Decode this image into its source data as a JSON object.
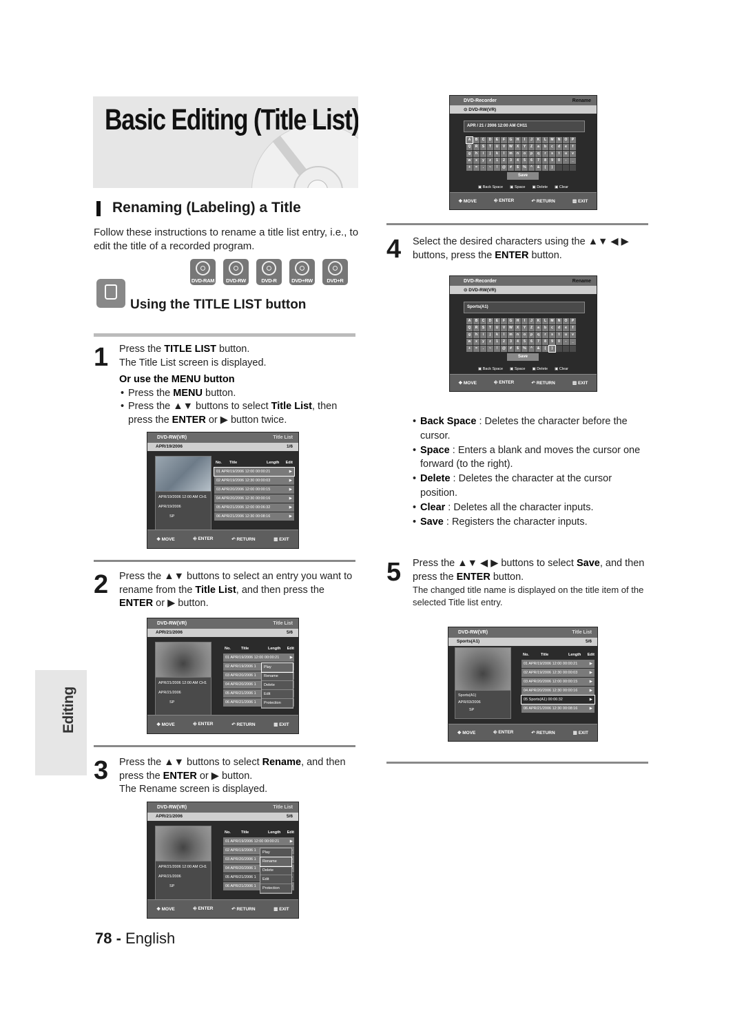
{
  "banner": {
    "title": "Basic Editing (Title List)"
  },
  "section": {
    "title": "Renaming (Labeling) a Title",
    "intro": "Follow these instructions to rename a title list entry, i.e., to edit the title of a recorded program."
  },
  "disc_icons": [
    "DVD-RAM",
    "DVD-RW",
    "DVD-R",
    "DVD+RW",
    "DVD+R"
  ],
  "subsection": {
    "title": "Using the TITLE LIST button"
  },
  "steps": {
    "s1": {
      "num": "1",
      "l1a": "Press the ",
      "l1b": "TITLE LIST",
      "l1c": " button.",
      "l2": "The Title List screen is displayed.",
      "or_heading": "Or use the MENU button",
      "b1a": "Press the ",
      "b1b": "MENU",
      "b1c": " button.",
      "b2a": "Press the ▲▼ buttons to select ",
      "b2b": "Title List",
      "b2c": ", then press the ",
      "b2d": "ENTER",
      "b2e": " or ▶ button twice."
    },
    "s2": {
      "num": "2",
      "a": "Press the ▲▼ buttons to select an entry you want to rename from the ",
      "b": "Title List",
      "c": ", and then press the ",
      "d": "ENTER",
      "e": " or ▶ button."
    },
    "s3": {
      "num": "3",
      "a": "Press the ▲▼  buttons to select ",
      "b": "Rename",
      "c": ", and then press the ",
      "d": "ENTER",
      "e": " or ▶ button.",
      "f": "The Rename screen is displayed."
    },
    "s4": {
      "num": "4",
      "a": "Select the desired characters using the ▲▼ ◀ ▶ buttons, press the ",
      "b": "ENTER",
      "c": " button."
    },
    "s5": {
      "num": "5",
      "a": "Press the ▲▼ ◀ ▶  buttons to select ",
      "b": "Save",
      "c": ", and then press the ",
      "d": "ENTER",
      "e": " button.",
      "f": "The changed title name is displayed on the title item of the selected Title list entry."
    }
  },
  "key_help": [
    {
      "term": "Back Space",
      "desc": " : Deletes the character before the cursor."
    },
    {
      "term": "Space",
      "desc": " : Enters a blank and moves the cursor one forward (to the right)."
    },
    {
      "term": "Delete",
      "desc": " : Deletes the character at the cursor position."
    },
    {
      "term": "Clear",
      "desc": " : Deletes all the character inputs."
    },
    {
      "term": "Save",
      "desc": " : Registers the character inputs."
    }
  ],
  "osd_common": {
    "disc": "DVD-RW(VR)",
    "title_list": "Title List",
    "col_no": "No.",
    "col_title": "Title",
    "col_length": "Length",
    "col_edit": "Edit",
    "footer": {
      "move": "MOVE",
      "enter": "ENTER",
      "return": "RETURN",
      "exit": "EXIT"
    },
    "quality": "SP",
    "recorder": "DVD-Recorder",
    "rename": "Rename",
    "save": "Save",
    "kfoot": {
      "backspace": "Back Space",
      "space": "Space",
      "delete": "Delete",
      "clear": "Clear"
    },
    "menu": [
      "Play",
      "Rename",
      "Delete",
      "Edit",
      "Protection"
    ]
  },
  "osd1": {
    "date": "APR/19/2006",
    "page": "1/6",
    "info1": "APR/19/2006 12:00 AM CH1",
    "info2": "APR/19/2006",
    "rows": [
      "01 APR/19/2006  12:00  00:00:21",
      "02 APR/19/2006  12:30  00:00:03",
      "03 APR/20/2006  12:00  00:00:15",
      "04 APR/20/2006  12:30  00:00:16",
      "05 APR/21/2006  12:00  00:06:32",
      "06 APR/21/2006  12:30  00:08:16"
    ]
  },
  "osd2": {
    "date": "APR/21/2006",
    "page": "5/6",
    "info1": "APR/21/2006 12:00 AM CH1",
    "info2": "APR/21/2006",
    "row1": "01 APR/19/2006  12:00  00:00:21",
    "rows_short": [
      "02 APR/19/2006  1",
      "03 APR/20/2006  1",
      "04 APR/20/2006  1",
      "05 APR/21/2006  1",
      "06 APR/21/2006  1"
    ]
  },
  "osd_rename1": {
    "input": "APR / 21 / 2006   12:00   AM   CH11"
  },
  "osd_rename2": {
    "input": "Sports(A1)"
  },
  "keyboard": [
    [
      "A",
      "B",
      "C",
      "D",
      "E",
      "F",
      "G",
      "H",
      "I",
      "J",
      "K",
      "L",
      "M",
      "N",
      "O",
      "P"
    ],
    [
      "Q",
      "R",
      "S",
      "T",
      "U",
      "V",
      "W",
      "X",
      "Y",
      "Z",
      "a",
      "b",
      "c",
      "d",
      "e",
      "f"
    ],
    [
      "g",
      "h",
      "i",
      "j",
      "k",
      "l",
      "m",
      "n",
      "o",
      "p",
      "q",
      "r",
      "s",
      "t",
      "u",
      "v"
    ],
    [
      "w",
      "x",
      "y",
      "z",
      "1",
      "2",
      "3",
      "4",
      "5",
      "6",
      "7",
      "8",
      "9",
      "0",
      "-",
      "_"
    ],
    [
      "+",
      "=",
      ".",
      "~",
      "!",
      "@",
      "#",
      "$",
      "%",
      "^",
      "&",
      "(",
      ")",
      "",
      "",
      ""
    ]
  ],
  "osd_final": {
    "date": "Sports(A1)",
    "page": "5/6",
    "info1": "Sports(A1)",
    "info2": "APR/03/2006",
    "rows": [
      "01 APR/19/2006  12:00  00:00:21",
      "02 APR/19/2006  12:30  00:00:03",
      "03 APR/20/2006  12:00  00:00:15",
      "04 APR/20/2006  12:30  00:00:16",
      "05      Sports(A1)          00:06:32",
      "06 APR/21/2006  12:30  00:08:16"
    ]
  },
  "side_tab": "Editing",
  "page_number": {
    "num": "78 - ",
    "lang": "English"
  }
}
